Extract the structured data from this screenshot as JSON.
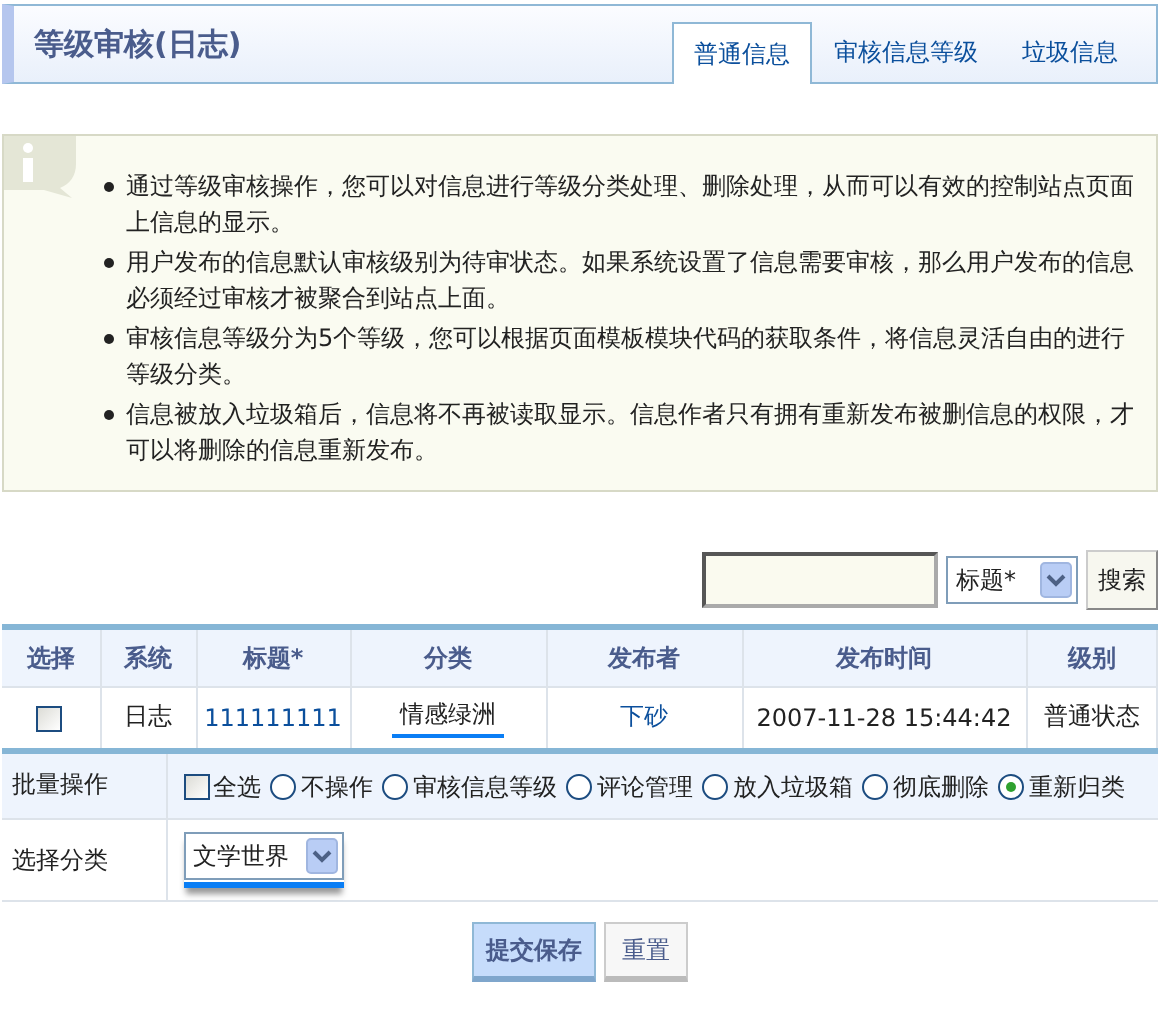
{
  "header": {
    "title": "等级审核(日志)",
    "tabs": [
      {
        "label": "普通信息",
        "selected": true
      },
      {
        "label": "审核信息等级",
        "selected": false
      },
      {
        "label": "垃圾信息",
        "selected": false
      }
    ]
  },
  "info": {
    "items": [
      "通过等级审核操作，您可以对信息进行等级分类处理、删除处理，从而可以有效的控制站点页面上信息的显示。",
      "用户发布的信息默认审核级别为待审状态。如果系统设置了信息需要审核，那么用户发布的信息必须经过审核才被聚合到站点上面。",
      "审核信息等级分为5个等级，您可以根据页面模板模块代码的获取条件，将信息灵活自由的进行等级分类。",
      "信息被放入垃圾箱后，信息将不再被读取显示。信息作者只有拥有重新发布被删信息的权限，才可以将删除的信息重新发布。"
    ]
  },
  "search": {
    "field": "标题*",
    "button": "搜索"
  },
  "table": {
    "columns": [
      "选择",
      "系统",
      "标题*",
      "分类",
      "发布者",
      "发布时间",
      "级别"
    ],
    "rows": [
      {
        "checked": false,
        "system": "日志",
        "title": "111111111",
        "category": "情感绿洲",
        "author": "下砂",
        "time": "2007-11-28 15:44:42",
        "level": "普通状态"
      }
    ]
  },
  "batch": {
    "label": "批量操作",
    "select_all": {
      "label": "全选",
      "checked": false
    },
    "options": [
      {
        "label": "不操作",
        "selected": false
      },
      {
        "label": "审核信息等级",
        "selected": false
      },
      {
        "label": "评论管理",
        "selected": false
      },
      {
        "label": "放入垃圾箱",
        "selected": false
      },
      {
        "label": "彻底删除",
        "selected": false
      },
      {
        "label": "重新归类",
        "selected": true
      }
    ]
  },
  "category": {
    "label": "选择分类",
    "value": "文学世界"
  },
  "buttons": [
    "提交保存",
    "重置"
  ]
}
